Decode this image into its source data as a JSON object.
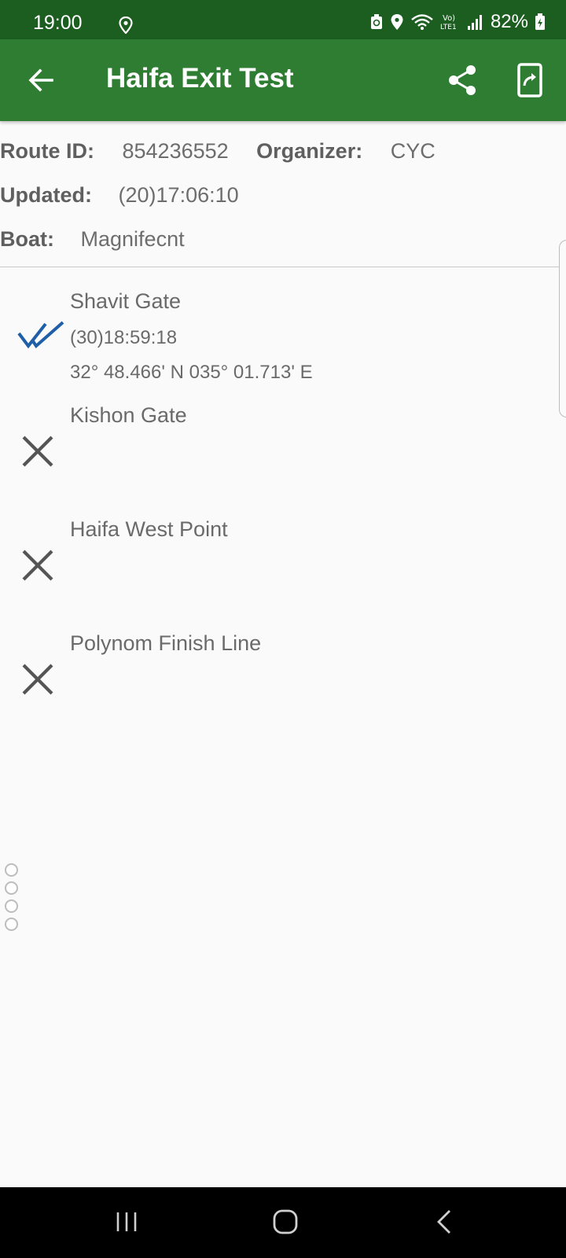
{
  "status_bar": {
    "time": "19:00",
    "battery": "82%",
    "icons": [
      "location-icon",
      "recycle-icon",
      "location-icon",
      "wifi-icon",
      "volte-icon",
      "signal-icon",
      "battery-icon"
    ]
  },
  "app_bar": {
    "title": "Haifa Exit Test",
    "icons": [
      "back-arrow-icon",
      "share-icon",
      "export-icon"
    ],
    "color": "#2e7d32"
  },
  "info": {
    "route_id_label": "Route ID:",
    "route_id_value": "854236552",
    "organizer_label": "Organizer:",
    "organizer_value": "CYC",
    "updated_label": "Updated:",
    "updated_value": "(20)17:06:10",
    "boat_label": "Boat:",
    "boat_value": "Magnifecnt"
  },
  "waypoints": [
    {
      "name": "Shavit Gate",
      "status": "passed",
      "time": "(30)18:59:18",
      "coords": "32° 48.466' N 035° 01.713' E",
      "icon": "double-check-icon"
    },
    {
      "name": "Kishon Gate",
      "status": "missed",
      "icon": "cross-icon"
    },
    {
      "name": "Haifa West Point",
      "status": "missed",
      "icon": "cross-icon"
    },
    {
      "name": "Polynom Finish Line",
      "status": "missed",
      "icon": "cross-icon"
    }
  ],
  "colors": {
    "status_bar": "#1b5e20",
    "app_bar": "#2e7d32",
    "check": "#1e5fa8",
    "cross": "#555555"
  }
}
